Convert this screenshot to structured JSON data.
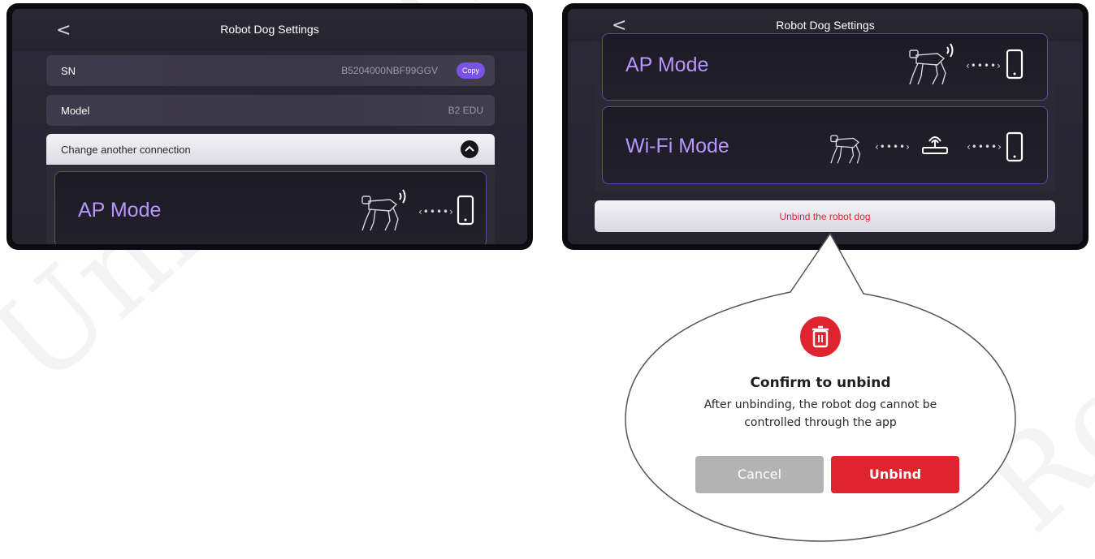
{
  "watermark": {
    "left_text": "Unitree Robotics",
    "right_text": "Robotics"
  },
  "left_screen": {
    "title": "Robot Dog Settings",
    "back_glyph": "<",
    "sn": {
      "label": "SN",
      "value": "B5204000NBF99GGV",
      "copy_label": "Copy"
    },
    "model": {
      "label": "Model",
      "value": "B2 EDU"
    },
    "change_connection": {
      "label": "Change another connection"
    },
    "ap_card": {
      "title": "AP Mode",
      "dots": "‹••••›"
    }
  },
  "right_screen": {
    "title": "Robot Dog Settings",
    "back_glyph": "<",
    "ap_card": {
      "title": "AP Mode",
      "dots": "‹••••›"
    },
    "wifi_card": {
      "title": "Wi-Fi Mode",
      "dots1": "‹••••›",
      "dots2": "‹••••›"
    },
    "unbind_bar": {
      "label": "Unbind the robot dog"
    }
  },
  "dialog": {
    "icon": "trash-icon",
    "title": "Confirm to unbind",
    "message_line1": "After unbinding, the robot dog cannot be",
    "message_line2": "controlled through the app",
    "cancel_label": "Cancel",
    "unbind_label": "Unbind"
  },
  "colors": {
    "accent": "#7a52e6",
    "mode_text": "#b795ff",
    "danger": "#e0242f",
    "cancel": "#b3b3b3"
  }
}
